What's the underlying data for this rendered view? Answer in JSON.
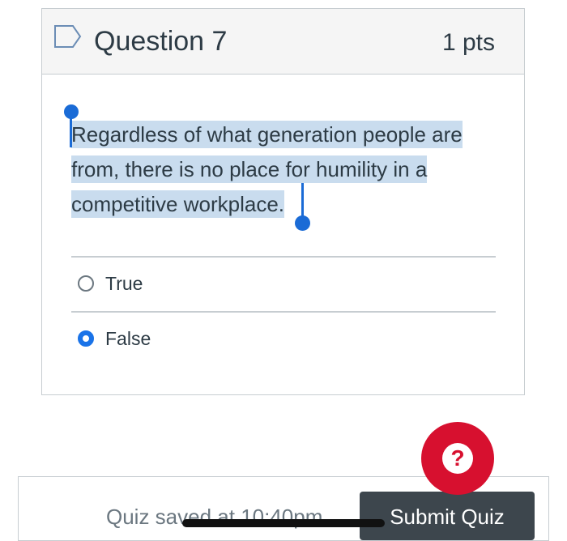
{
  "question": {
    "title": "Question 7",
    "points": "1 pts",
    "text": "Regardless of what generation people are from, there is no place for humility in a competitive workplace."
  },
  "answers": [
    {
      "label": "True",
      "selected": false
    },
    {
      "label": "False",
      "selected": true
    }
  ],
  "footer": {
    "saved_text": "Quiz saved at 10:40pm",
    "submit_label": "Submit Quiz"
  },
  "help": {
    "symbol": "?"
  },
  "colors": {
    "accent": "#1a73e8",
    "help": "#d7102f",
    "selection": "#c9dcee"
  },
  "icons": [
    "flag-icon",
    "help-icon"
  ]
}
